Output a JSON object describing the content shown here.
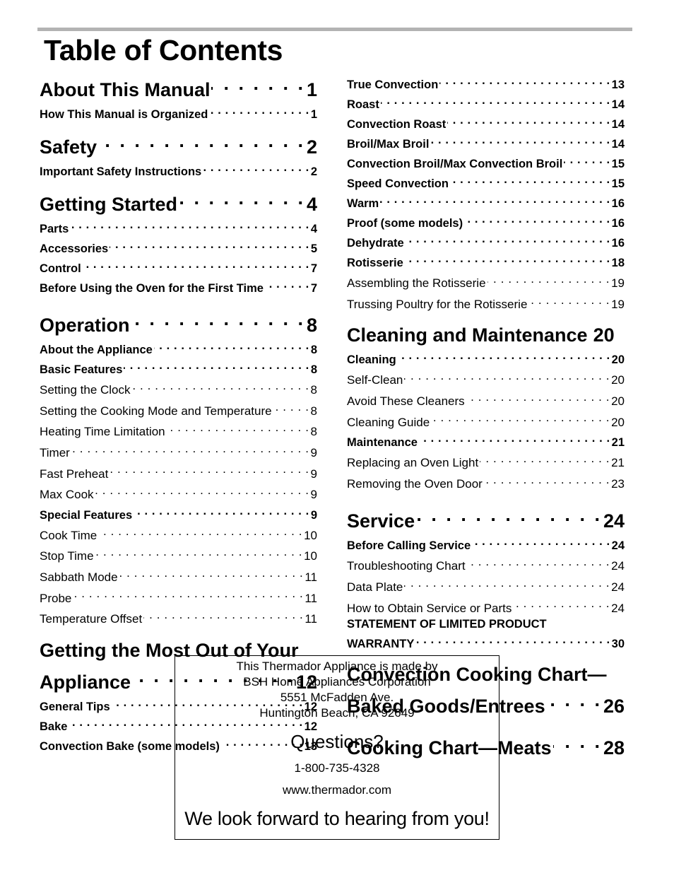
{
  "document": {
    "title": "Table of Contents"
  },
  "toc_left": {
    "about": {
      "label": "About This Manual",
      "page": "1"
    },
    "how_organized": {
      "label": "How This Manual is Organized",
      "page": "1"
    },
    "safety": {
      "label": "Safety",
      "page": "2"
    },
    "important_safety": {
      "label": "Important Safety Instructions",
      "page": "2"
    },
    "getting_started": {
      "label": "Getting Started",
      "page": "4"
    },
    "parts": {
      "label": "Parts",
      "page": "4"
    },
    "accessories": {
      "label": "Accessories",
      "page": "5"
    },
    "control": {
      "label": "Control",
      "page": "7"
    },
    "before_first_time": {
      "label": "Before Using the Oven for the First Time",
      "page": "7"
    },
    "operation": {
      "label": "Operation",
      "page": "8"
    },
    "about_appliance": {
      "label": "About the Appliance",
      "page": "8"
    },
    "basic_features": {
      "label": "Basic Features",
      "page": "8"
    },
    "setting_clock": {
      "label": "Setting the Clock",
      "page": "8"
    },
    "setting_mode": {
      "label": "Setting the Cooking Mode and Temperature",
      "page": "8"
    },
    "heating_limit": {
      "label": "Heating Time Limitation",
      "page": "8"
    },
    "timer": {
      "label": "Timer",
      "page": "9"
    },
    "fast_preheat": {
      "label": "Fast Preheat",
      "page": "9"
    },
    "max_cook": {
      "label": "Max Cook",
      "page": "9"
    },
    "special_features": {
      "label": "Special Features",
      "page": "9"
    },
    "cook_time": {
      "label": "Cook Time",
      "page": "10"
    },
    "stop_time": {
      "label": "Stop Time",
      "page": "10"
    },
    "sabbath": {
      "label": "Sabbath Mode",
      "page": "11"
    },
    "probe": {
      "label": "Probe",
      "page": "11"
    },
    "temp_offset": {
      "label": "Temperature Offset",
      "page": "11"
    },
    "most_out_line1": {
      "label": "Getting the Most Out of Your"
    },
    "most_out_line2": {
      "label": "Appliance",
      "page": "12"
    },
    "general_tips": {
      "label": "General Tips",
      "page": "12"
    },
    "bake": {
      "label": "Bake",
      "page": "12"
    },
    "convection_bake": {
      "label": "Convection Bake (some models)",
      "page": "13"
    }
  },
  "toc_right": {
    "true_convection": {
      "label": "True Convection",
      "page": "13"
    },
    "roast": {
      "label": "Roast",
      "page": "14"
    },
    "convection_roast": {
      "label": "Convection Roast",
      "page": "14"
    },
    "broil": {
      "label": "Broil/Max Broil",
      "page": "14"
    },
    "convection_broil": {
      "label": "Convection Broil/Max Convection Broil",
      "page": "15"
    },
    "speed_convection": {
      "label": "Speed Convection",
      "page": "15"
    },
    "warm": {
      "label": "Warm",
      "page": "16"
    },
    "proof": {
      "label": "Proof (some models)",
      "page": "16"
    },
    "dehydrate": {
      "label": "Dehydrate",
      "page": "16"
    },
    "rotisserie": {
      "label": "Rotisserie",
      "page": "18"
    },
    "assembling_rotisserie": {
      "label": "Assembling the Rotisserie",
      "page": "19"
    },
    "trussing_poultry": {
      "label": "Trussing Poultry for the Rotisserie",
      "page": "19"
    },
    "cleaning_maintenance": {
      "label": "Cleaning and Maintenance",
      "page": "20"
    },
    "cleaning": {
      "label": "Cleaning",
      "page": "20"
    },
    "self_clean": {
      "label": "Self-Clean",
      "page": "20"
    },
    "avoid_cleaners": {
      "label": "Avoid These Cleaners",
      "page": "20"
    },
    "cleaning_guide": {
      "label": "Cleaning Guide",
      "page": "20"
    },
    "maintenance": {
      "label": "Maintenance",
      "page": "21"
    },
    "oven_light": {
      "label": "Replacing an Oven Light",
      "page": "21"
    },
    "oven_door": {
      "label": "Removing the Oven Door",
      "page": "23"
    },
    "service": {
      "label": "Service",
      "page": "24"
    },
    "before_calling": {
      "label": "Before Calling Service",
      "page": "24"
    },
    "troubleshooting": {
      "label": "Troubleshooting Chart",
      "page": "24"
    },
    "data_plate": {
      "label": "Data Plate",
      "page": "24"
    },
    "obtain_service": {
      "label": "How to Obtain Service or Parts",
      "page": "24"
    },
    "warranty_line1": {
      "label": "STATEMENT OF LIMITED PRODUCT"
    },
    "warranty_line2": {
      "label": "WARRANTY",
      "page": "30"
    },
    "conv_chart_line1": {
      "label": "Convection Cooking Chart—"
    },
    "conv_chart_line2": {
      "label": "Baked Goods/Entrees",
      "page": "26"
    },
    "meats_chart": {
      "label": "Cooking Chart—Meats",
      "page": "28"
    }
  },
  "info_box": {
    "line1": "This Thermador Appliance is made by",
    "line2": "BSH Home Appliances Corporation",
    "line3": "5551 McFadden Ave.",
    "line4": "Huntington Beach, CA 92649",
    "questions": "Questions?",
    "phone": "1-800-735-4328",
    "website": "www.thermador.com",
    "closing": "We look forward to hearing from you!"
  }
}
